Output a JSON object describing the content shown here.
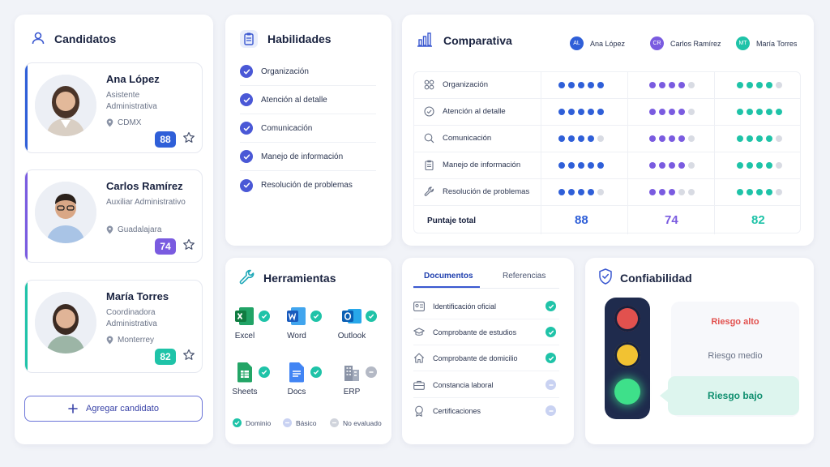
{
  "candidates": {
    "title": "Candidatos",
    "items": [
      {
        "name": "Ana López",
        "role": "Asistente Administrativa",
        "location": "CDMX",
        "score": "88",
        "color": "#2f5fd8"
      },
      {
        "name": "Carlos Ramírez",
        "role": "Auxiliar Administrativo",
        "location": "Guadalajara",
        "score": "74",
        "color": "#7a5be0"
      },
      {
        "name": "María Torres",
        "role": "Coordinadora Administrativa",
        "location": "Monterrey",
        "score": "82",
        "color": "#1fc3a8"
      }
    ],
    "add_label": "Agregar candidato"
  },
  "skills": {
    "title": "Habilidades",
    "items": [
      "Organización",
      "Atención al detalle",
      "Comunicación",
      "Manejo de información",
      "Resolución de problemas"
    ]
  },
  "comparison": {
    "title": "Comparativa",
    "legend": [
      {
        "initials": "AL",
        "name": "Ana López",
        "color": "#2f5fd8"
      },
      {
        "initials": "CR",
        "name": "Carlos Ramírez",
        "color": "#7a5be0"
      },
      {
        "initials": "MT",
        "name": "María Torres",
        "color": "#1fc3a8"
      }
    ],
    "rows": [
      {
        "label": "Organización",
        "icon": "grid-icon",
        "ratings": [
          5,
          4,
          4
        ]
      },
      {
        "label": "Atención al detalle",
        "icon": "check-circle-icon",
        "ratings": [
          5,
          4,
          5
        ]
      },
      {
        "label": "Comunicación",
        "icon": "search-icon",
        "ratings": [
          4,
          4,
          4
        ]
      },
      {
        "label": "Manejo de información",
        "icon": "clipboard-icon",
        "ratings": [
          5,
          4,
          4
        ]
      },
      {
        "label": "Resolución de problemas",
        "icon": "wrench-icon",
        "ratings": [
          4,
          3,
          4
        ]
      }
    ],
    "total_label": "Puntaje total",
    "totals": [
      "88",
      "74",
      "82"
    ],
    "max_rating": 5
  },
  "tools": {
    "title": "Herramientas",
    "items": [
      {
        "name": "Excel",
        "status": "Dominio"
      },
      {
        "name": "Word",
        "status": "Dominio"
      },
      {
        "name": "Outlook",
        "status": "Dominio"
      },
      {
        "name": "Sheets",
        "status": "Dominio"
      },
      {
        "name": "Docs",
        "status": "Dominio"
      },
      {
        "name": "ERP",
        "status": "No evaluado"
      }
    ],
    "legend": [
      "Dominio",
      "Básico",
      "No evaluado"
    ]
  },
  "documents": {
    "tabs": [
      "Documentos",
      "Referencias"
    ],
    "active_tab": "Documentos",
    "items": [
      {
        "label": "Identificación oficial",
        "verified": true
      },
      {
        "label": "Comprobante de estudios",
        "verified": true
      },
      {
        "label": "Comprobante de domicilio",
        "verified": true
      },
      {
        "label": "Constancia laboral",
        "verified": false
      },
      {
        "label": "Certificaciones",
        "verified": false
      }
    ]
  },
  "reliability": {
    "title": "Confiabilidad",
    "levels": [
      "Riesgo alto",
      "Riesgo medio",
      "Riesgo bajo"
    ],
    "active_level": "Riesgo bajo"
  },
  "colors": {
    "blue": "#2f5fd8",
    "purple": "#7a5be0",
    "teal": "#1fc3a8",
    "empty_dot": "#d8dbe3",
    "check": "#1fc3a8"
  }
}
